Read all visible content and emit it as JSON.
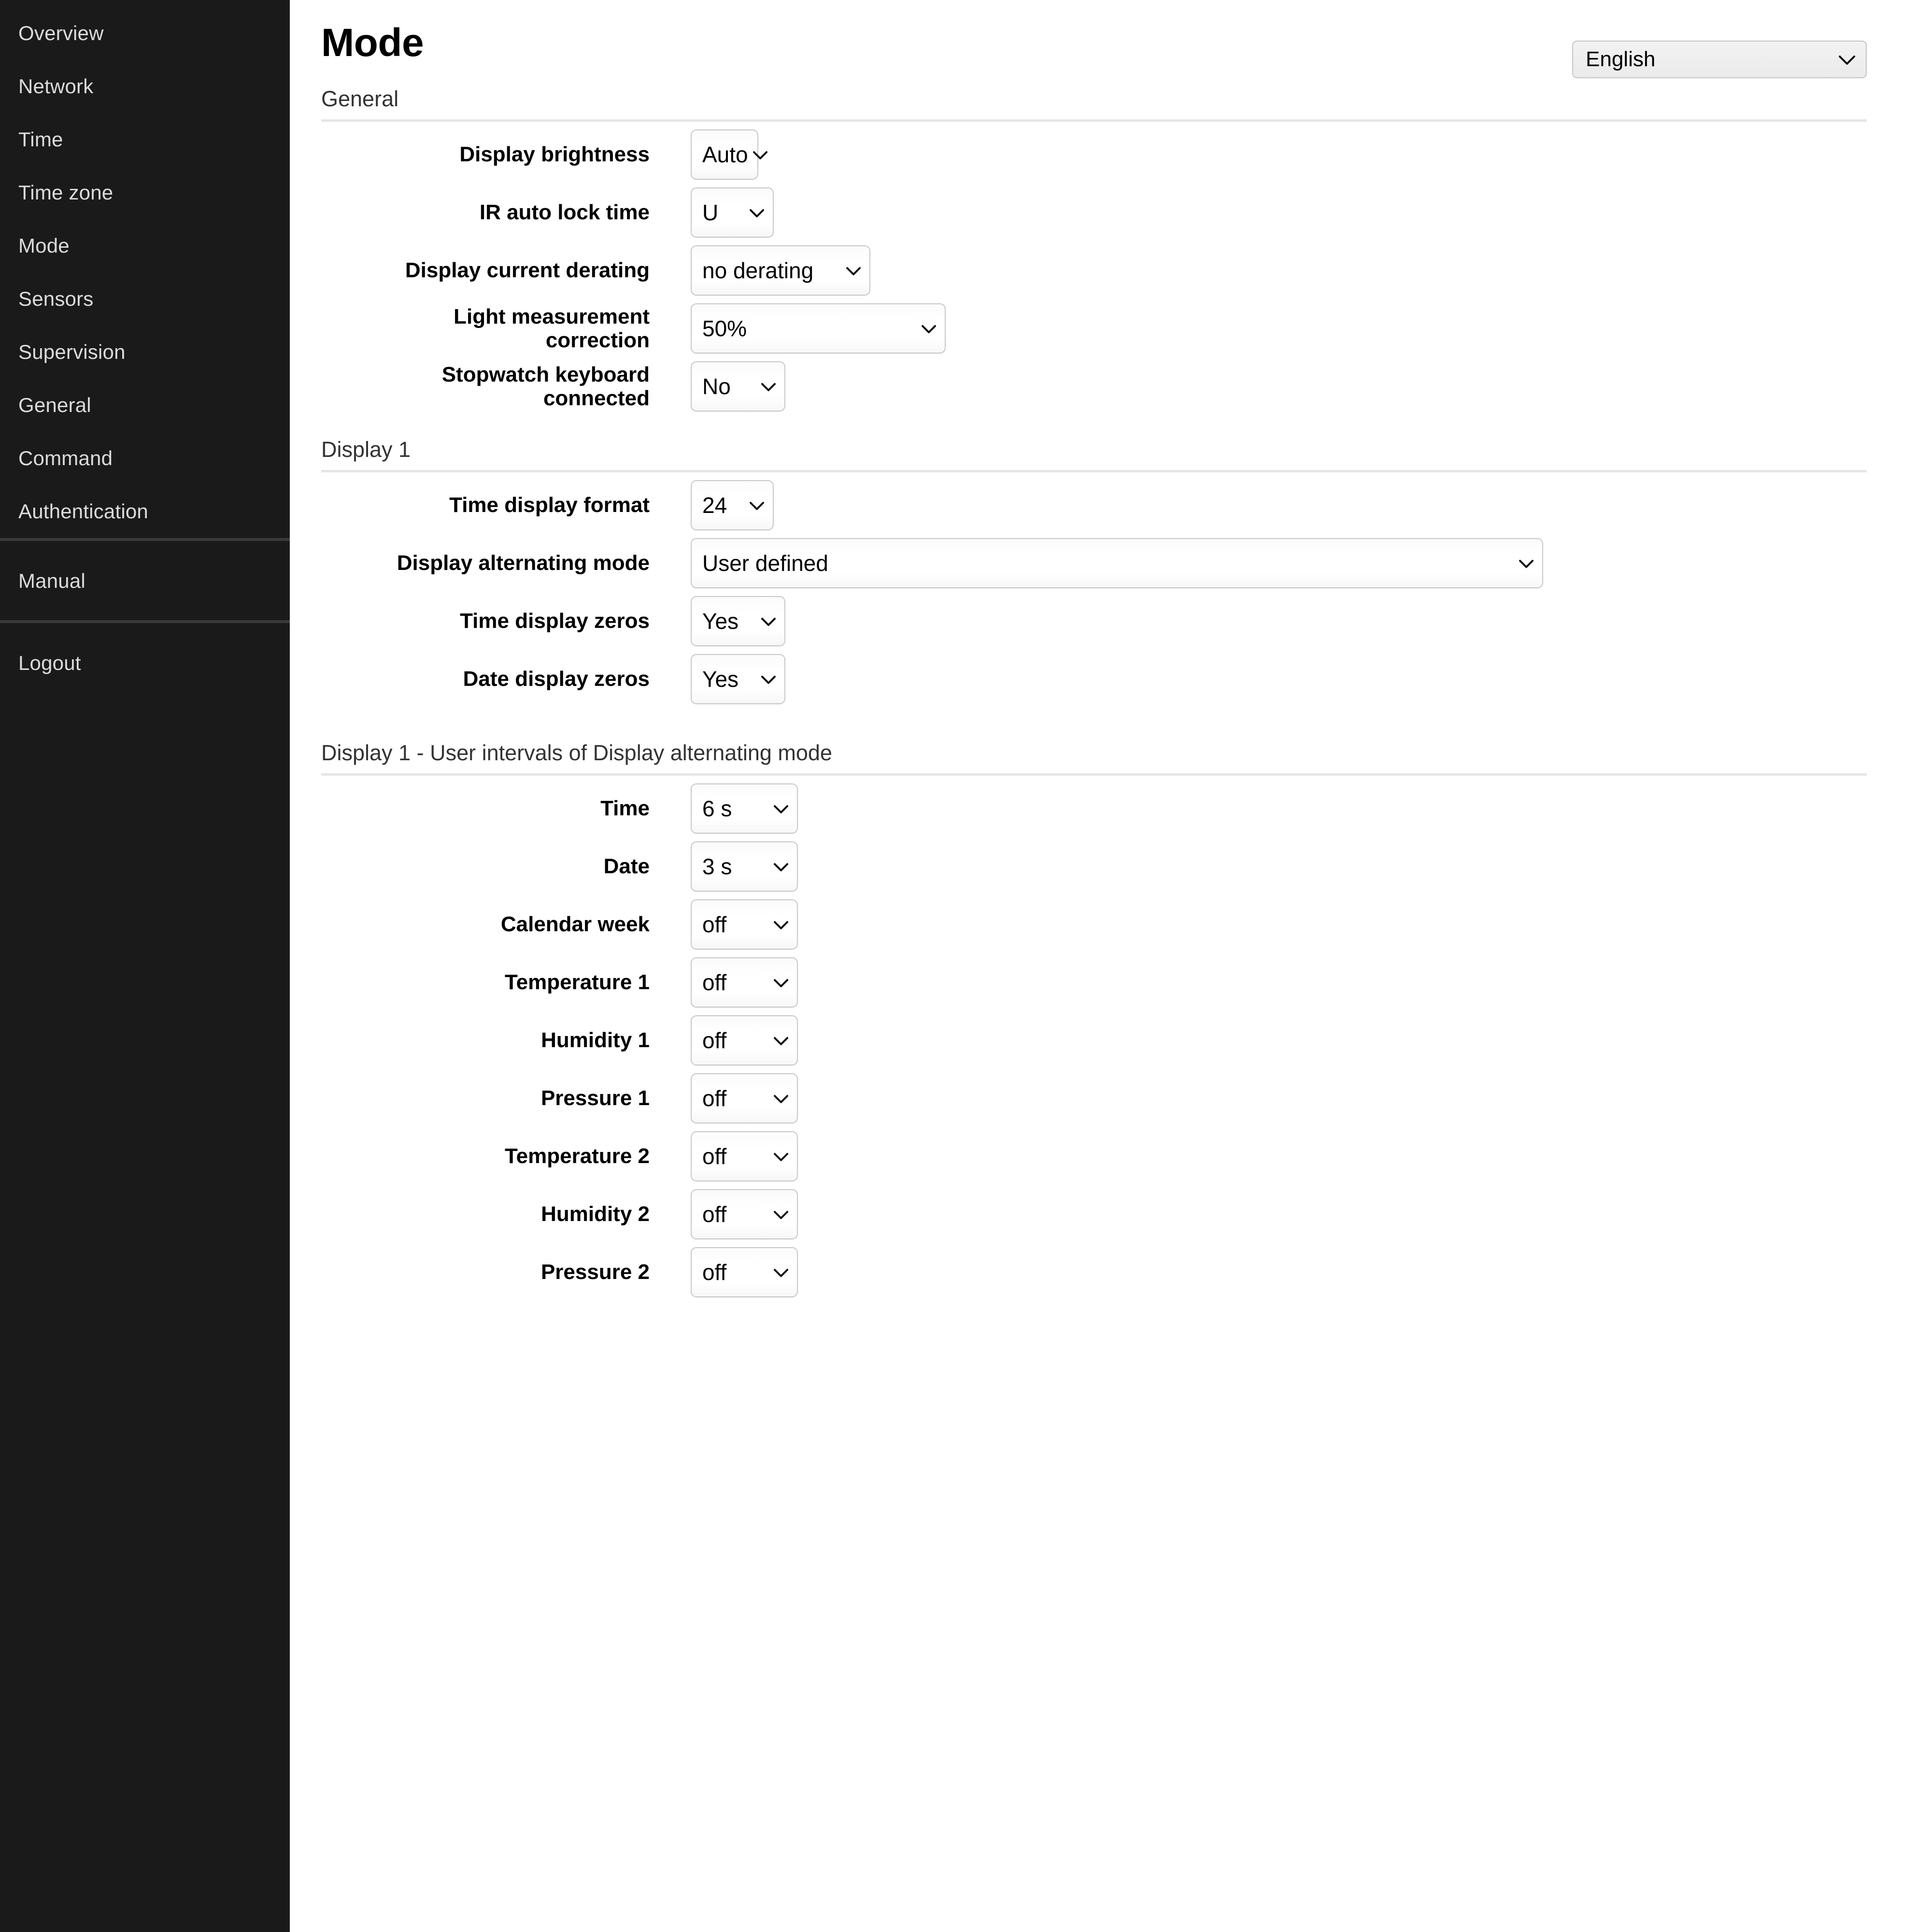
{
  "sidebar": {
    "primary_items": [
      {
        "label": "Overview"
      },
      {
        "label": "Network"
      },
      {
        "label": "Time"
      },
      {
        "label": "Time zone"
      },
      {
        "label": "Mode"
      },
      {
        "label": "Sensors"
      },
      {
        "label": "Supervision"
      },
      {
        "label": "General"
      },
      {
        "label": "Command"
      },
      {
        "label": "Authentication"
      }
    ],
    "manual_item": {
      "label": "Manual"
    },
    "logout_item": {
      "label": "Logout"
    },
    "background_color": "#1a1a1a",
    "text_color": "#dcdcdc",
    "separator_color": "#3a3a3a"
  },
  "header": {
    "title": "Mode",
    "language": {
      "value": "English",
      "chevron": "chevron-down-icon",
      "options": [
        "English"
      ]
    }
  },
  "sections": [
    {
      "id": "general",
      "heading": "General",
      "rows": [
        {
          "label": "Display brightness",
          "value": "Auto",
          "size": "w-auto"
        },
        {
          "label": "IR auto lock time",
          "value": "U",
          "size": "w-xsmall"
        },
        {
          "label": "Display current derating",
          "value": "no derating",
          "size": "w-derate"
        },
        {
          "label": "Light measurement\ncorrection",
          "value": "50%",
          "size": "w-pct"
        },
        {
          "label": "Stopwatch keyboard\nconnected",
          "value": "No",
          "size": "w-small"
        }
      ]
    },
    {
      "id": "display1",
      "heading": "Display 1",
      "rows": [
        {
          "label": "Time display format",
          "value": "24",
          "size": "w-xsmall"
        },
        {
          "label": "Display alternating mode",
          "value": "User defined",
          "size": "w-wide"
        },
        {
          "label": "Time display zeros",
          "value": "Yes",
          "size": "w-small"
        },
        {
          "label": "Date display zeros",
          "value": "Yes",
          "size": "w-small"
        }
      ]
    },
    {
      "id": "display1-intervals",
      "heading": "Display 1 - User intervals of Display alternating mode",
      "rows": [
        {
          "label": "Time",
          "value": "6 s",
          "size": "w-off"
        },
        {
          "label": "Date",
          "value": "3 s",
          "size": "w-off"
        },
        {
          "label": "Calendar week",
          "value": "off",
          "size": "w-off"
        },
        {
          "label": "Temperature 1",
          "value": "off",
          "size": "w-off"
        },
        {
          "label": "Humidity 1",
          "value": "off",
          "size": "w-off"
        },
        {
          "label": "Pressure 1",
          "value": "off",
          "size": "w-off"
        },
        {
          "label": "Temperature 2",
          "value": "off",
          "size": "w-off"
        },
        {
          "label": "Humidity 2",
          "value": "off",
          "size": "w-off"
        },
        {
          "label": "Pressure 2",
          "value": "off",
          "size": "w-off"
        }
      ]
    }
  ],
  "icons": {
    "chevron_down": "⌄"
  },
  "colors": {
    "page_background": "#ffffff",
    "text": "#000000",
    "section_heading": "#333333",
    "rule": "#e6e6e6",
    "select_border": "#c8c8c8"
  }
}
